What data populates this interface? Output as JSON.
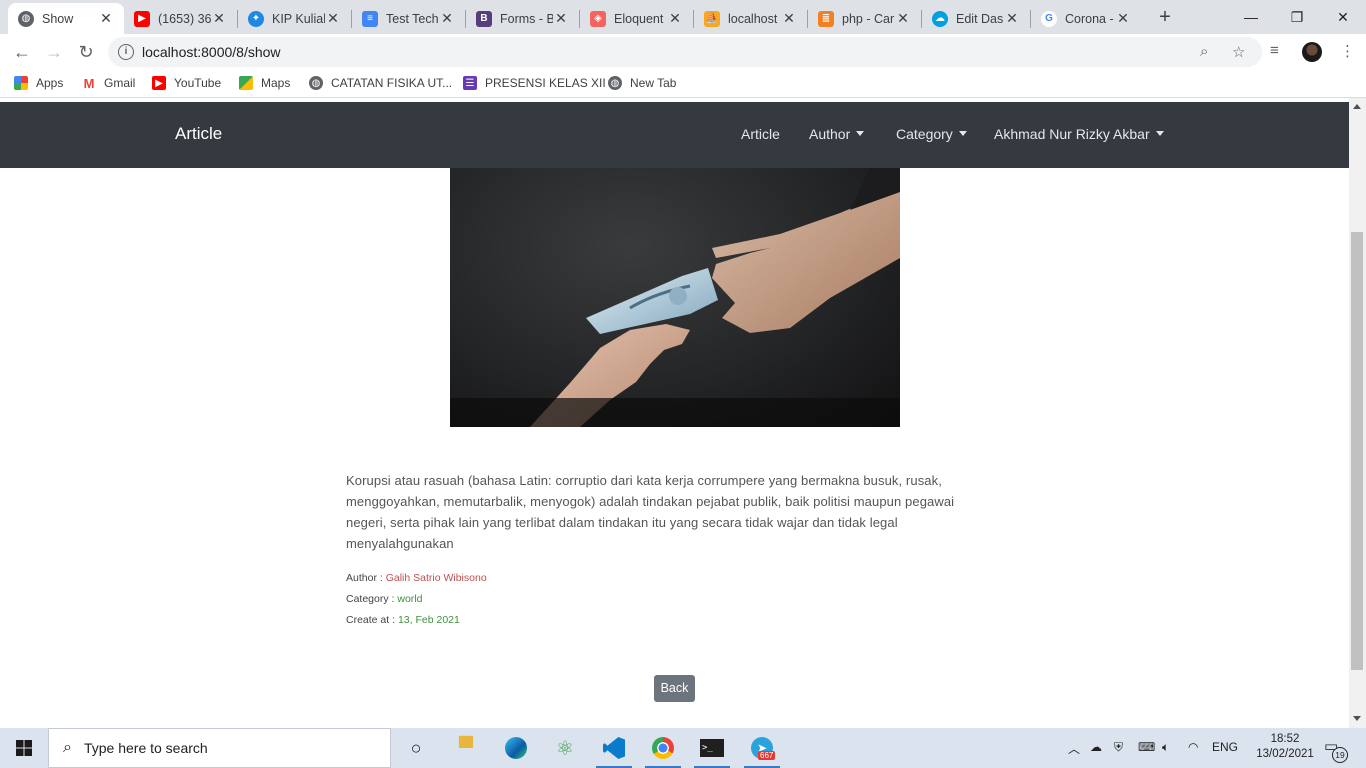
{
  "browser": {
    "tabs": [
      {
        "title": "Show",
        "icon": "globe-icon",
        "color": "#5f6368",
        "active": true
      },
      {
        "title": "(1653) 36",
        "icon": "youtube-icon",
        "color": "#ff0000"
      },
      {
        "title": "KIP Kuliah",
        "icon": "kip-icon",
        "color": "#1e88e5"
      },
      {
        "title": "Test Tech",
        "icon": "google-docs-icon",
        "color": "#4285f4"
      },
      {
        "title": "Forms - B",
        "icon": "bootstrap-icon",
        "color": "#563d7c"
      },
      {
        "title": "Eloquent",
        "icon": "laravel-icon",
        "color": "#f4645f"
      },
      {
        "title": "localhost",
        "icon": "phpmyadmin-icon",
        "color": "#f6a821"
      },
      {
        "title": "php - Car",
        "icon": "stackoverflow-icon",
        "color": "#f48024"
      },
      {
        "title": "Edit Dash",
        "icon": "salesforce-icon",
        "color": "#00a1e0"
      },
      {
        "title": "Corona -",
        "icon": "google-icon",
        "color": "#4285f4"
      }
    ],
    "url": "localhost:8000/8/show",
    "bookmarks": [
      {
        "label": "Apps",
        "icon": "apps-grid-icon"
      },
      {
        "label": "Gmail",
        "icon": "gmail-icon"
      },
      {
        "label": "YouTube",
        "icon": "youtube-icon"
      },
      {
        "label": "Maps",
        "icon": "maps-icon"
      },
      {
        "label": "CATATAN FISIKA UT...",
        "icon": "globe-icon"
      },
      {
        "label": "PRESENSI KELAS XII",
        "icon": "forms-icon"
      },
      {
        "label": "New Tab",
        "icon": "globe-icon"
      }
    ]
  },
  "navbar": {
    "brand": "Article",
    "links": [
      {
        "label": "Article",
        "dropdown": false
      },
      {
        "label": "Author",
        "dropdown": true
      },
      {
        "label": "Category",
        "dropdown": true
      },
      {
        "label": "Akhmad Nur Rizky Akbar",
        "dropdown": true
      }
    ]
  },
  "article": {
    "body": "Korupsi atau rasuah (bahasa Latin: corruptio dari kata kerja corrumpere yang bermakna busuk, rusak, menggoyahkan, memutarbalik, menyogok) adalah tindakan pejabat publik, baik politisi maupun pegawai negeri, serta pihak lain yang terlibat dalam tindakan itu yang secara tidak wajar dan tidak legal menyalahgunakan",
    "author_label": "Author :",
    "author": "Galih Satrio Wibisono",
    "category_label": "Category :",
    "category": "world",
    "created_label": "Create at :",
    "created": "13, Feb 2021",
    "back_label": "Back"
  },
  "taskbar": {
    "search_placeholder": "Type here to search",
    "language": "ENG",
    "time": "18:52",
    "date": "13/02/2021",
    "notifications": "19",
    "telegram_badge": "667"
  },
  "colors": {
    "navbar_bg": "#343a40",
    "author_color": "#c0504d",
    "category_color": "#3f8f3f",
    "back_button_bg": "#6c757d"
  }
}
